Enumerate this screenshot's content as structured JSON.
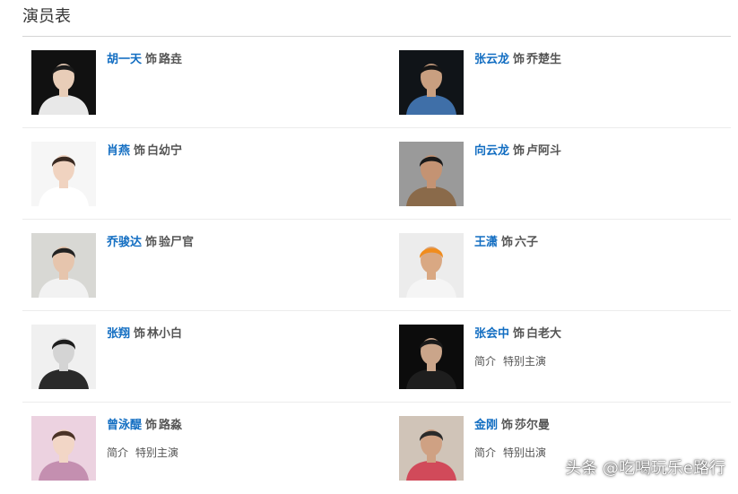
{
  "header": {
    "title": "演员表"
  },
  "labels": {
    "shi": "饰",
    "intro": "简介"
  },
  "cast": [
    {
      "actor": "胡一天",
      "role": "路垚",
      "note": "",
      "photo": {
        "bg": "#111111",
        "skin": "#e8cdb8",
        "hair": "#1b1b1b",
        "cloth": "#e8e8e8"
      }
    },
    {
      "actor": "张云龙",
      "role": "乔楚生",
      "note": "",
      "photo": {
        "bg": "#101418",
        "skin": "#c99f80",
        "hair": "#151515",
        "cloth": "#3f6fa8"
      }
    },
    {
      "actor": "肖燕",
      "role": "白幼宁",
      "note": "",
      "photo": {
        "bg": "#f6f6f6",
        "skin": "#f0d3c0",
        "hair": "#3a2a22",
        "cloth": "#ffffff"
      }
    },
    {
      "actor": "向云龙",
      "role": "卢阿斗",
      "note": "",
      "photo": {
        "bg": "#9a9a9a",
        "skin": "#c49373",
        "hair": "#1a1a1a",
        "cloth": "#8a6a4a"
      }
    },
    {
      "actor": "乔骏达",
      "role": "验尸官",
      "note": "",
      "photo": {
        "bg": "#d8d8d4",
        "skin": "#e6c5ad",
        "hair": "#222222",
        "cloth": "#f2f2f2"
      }
    },
    {
      "actor": "王潇",
      "role": "六子",
      "note": "",
      "photo": {
        "bg": "#ececec",
        "skin": "#d9a883",
        "hair": "#f08c1e",
        "cloth": "#f5f5f5"
      }
    },
    {
      "actor": "张翔",
      "role": "林小白",
      "note": "",
      "photo": {
        "bg": "#f0f0f0",
        "skin": "#d4d4d4",
        "hair": "#1c1c1c",
        "cloth": "#2a2a2a"
      }
    },
    {
      "actor": "张会中",
      "role": "白老大",
      "note": "特别主演",
      "photo": {
        "bg": "#0c0c0c",
        "skin": "#caa58a",
        "hair": "#1a1a1a",
        "cloth": "#1e1e1e"
      }
    },
    {
      "actor": "曾泳醍",
      "role": "路淼",
      "note": "特别主演",
      "photo": {
        "bg": "#ecd2e0",
        "skin": "#f2d6c6",
        "hair": "#4a3226",
        "cloth": "#c48fb0"
      }
    },
    {
      "actor": "金刚",
      "role": "莎尔曼",
      "note": "特别出演",
      "photo": {
        "bg": "#d0c4b8",
        "skin": "#cfa183",
        "hair": "#2a2a2a",
        "cloth": "#d14a5a"
      }
    }
  ],
  "watermark": "头条 @吃喝玩乐e路行"
}
